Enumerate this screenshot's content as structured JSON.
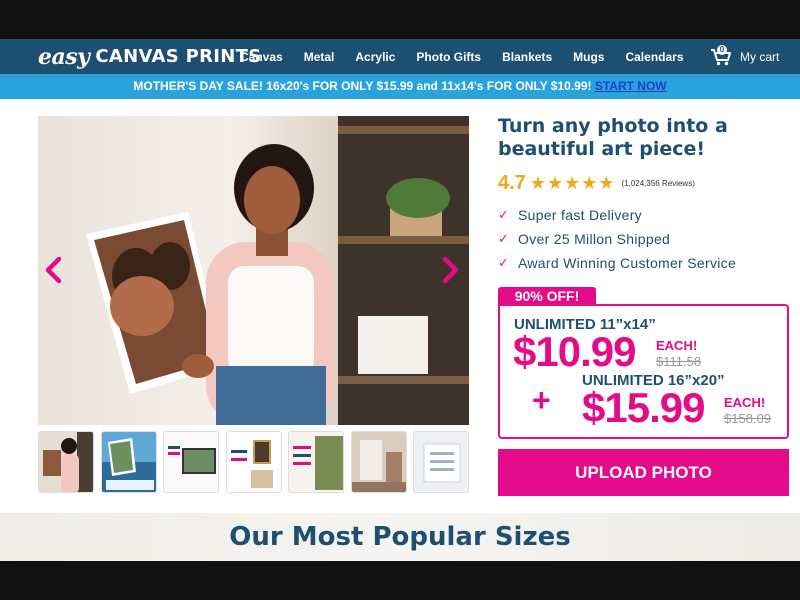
{
  "brand": {
    "logo_easy": "easy",
    "logo_name": "CANVAS PRINTS"
  },
  "nav": {
    "items": [
      {
        "label": "Canvas"
      },
      {
        "label": "Metal"
      },
      {
        "label": "Acrylic"
      },
      {
        "label": "Photo Gifts"
      },
      {
        "label": "Blankets"
      },
      {
        "label": "Mugs"
      },
      {
        "label": "Calendars"
      }
    ],
    "cart_count": "0",
    "cart_label": "My cart"
  },
  "promo": {
    "text": "MOTHER'S DAY SALE! 16x20's FOR ONLY $15.99 and 11x14's FOR ONLY $10.99!",
    "link": "START NOW"
  },
  "hero": {
    "arrow_left": "‹",
    "arrow_right": "›"
  },
  "product": {
    "headline": "Turn any photo into a beautiful art piece!",
    "rating_score": "4.7",
    "stars": "★★★★★",
    "rating_count": "(1,024,356 Reviews)",
    "features": [
      "Super fast Delivery",
      "Over 25 Millon Shipped",
      "Award Winning Customer Service"
    ]
  },
  "offer": {
    "tab": "90% OFF!",
    "title1": "UNLIMITED 11”x14”",
    "price1": "$10.99",
    "each1": "EACH!",
    "old1": "$111.58",
    "plus": "+",
    "title2": "UNLIMITED 16”x20”",
    "price2": "$15.99",
    "each2": "EACH!",
    "old2": "$158.09"
  },
  "upload_label": "UPLOAD PHOTO",
  "popular_title": "Our Most Popular Sizes",
  "colors": {
    "navy": "#1d4f73",
    "magenta": "#e30b8a",
    "sky": "#2aa3dc",
    "gold": "#f0a81c"
  }
}
